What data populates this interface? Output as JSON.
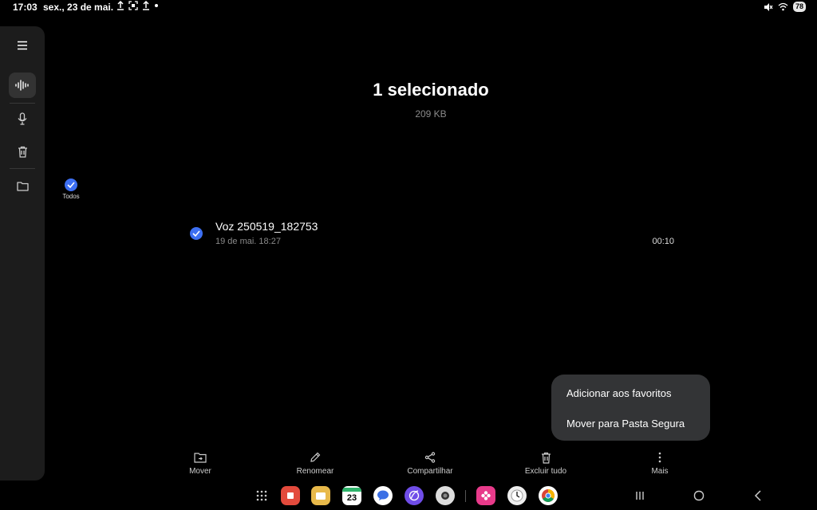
{
  "status_bar": {
    "time": "17:03",
    "date": "sex., 23 de mai.",
    "battery": "78",
    "icons_left": [
      "upload-icon",
      "screenshot-icon",
      "upload-icon",
      "dot-icon"
    ],
    "icons_right": [
      "mute-icon",
      "wifi-icon",
      "battery-icon"
    ]
  },
  "sidebar": {
    "items": [
      {
        "name": "menu",
        "icon": "hamburger-icon"
      },
      {
        "name": "recordings",
        "icon": "waveform-icon",
        "active": true
      },
      {
        "name": "record",
        "icon": "microphone-icon"
      },
      {
        "name": "trash",
        "icon": "trash-icon"
      },
      {
        "name": "folders",
        "icon": "folder-icon"
      }
    ]
  },
  "filter": {
    "label": "Todos"
  },
  "header": {
    "title": "1 selecionado",
    "size": "209 KB"
  },
  "recordings": [
    {
      "name": "Voz 250519_182753",
      "date": "19 de mai. 18:27",
      "duration": "00:10",
      "selected": true
    }
  ],
  "popup_menu": {
    "items": [
      "Adicionar aos favoritos",
      "Mover para Pasta Segura"
    ]
  },
  "actions": {
    "move": "Mover",
    "rename": "Renomear",
    "share": "Compartilhar",
    "delete_all": "Excluir tudo",
    "more": "Mais"
  },
  "taskbar": {
    "calendar_day": "23",
    "apps": [
      "apps-grid-icon",
      "notes-icon",
      "folder-app-icon",
      "calendar-icon",
      "messages-icon",
      "browser-icon",
      "camera-icon",
      "gallery-icon",
      "clock-icon",
      "chrome-icon"
    ],
    "nav": [
      "recents-icon",
      "home-icon",
      "back-icon"
    ]
  },
  "colors": {
    "accent": "#3d6ff2",
    "background": "#000000",
    "rail": "#1c1c1c",
    "menu": "#333436"
  }
}
